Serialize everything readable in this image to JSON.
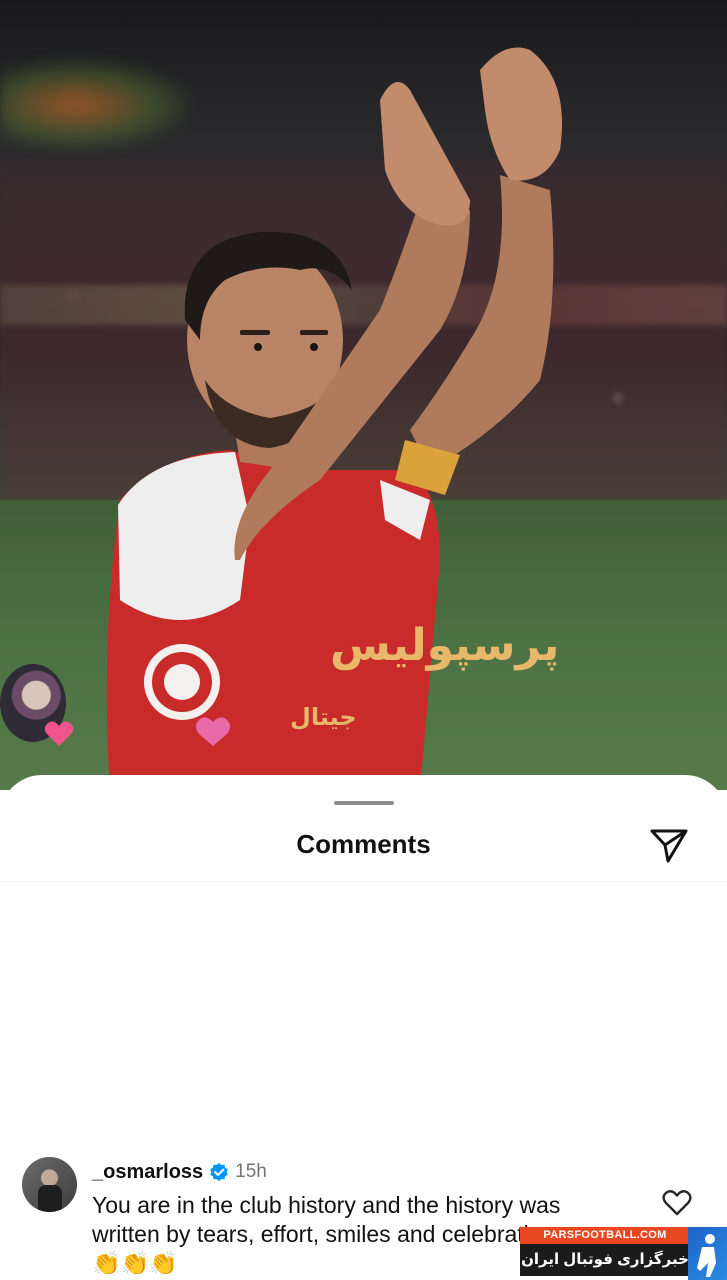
{
  "photo": {
    "jersey_text": "پرسپولیس",
    "jersey_subtext": "جیتال"
  },
  "sheet": {
    "title": "Comments"
  },
  "comment": {
    "username": "_osmarloss",
    "time": "15h",
    "text": "You are in the club history and the history was written by tears, effort, smiles and celebrations.",
    "emojis": "👏👏👏"
  },
  "watermark": {
    "site": "PARSFOOTBALL.COM",
    "tagline": "خبرگزاری فوتبال ایران"
  },
  "icons": {
    "share": "send-icon",
    "like": "heart-outline-icon",
    "verified": "verified-badge-icon",
    "story_reaction": "heart-icon"
  },
  "colors": {
    "verified_blue": "#0095f6",
    "jersey_red": "#c92b2b",
    "watermark_orange": "#e8471f"
  }
}
